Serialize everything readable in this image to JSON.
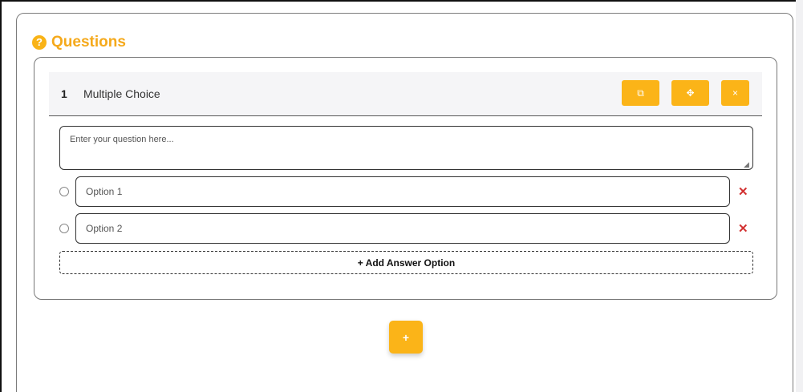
{
  "section": {
    "title": "Questions",
    "help_icon": "?"
  },
  "question": {
    "number": "1",
    "type": "Multiple Choice",
    "actions": {
      "duplicate_icon": "⧉",
      "move_icon": "✥",
      "delete_icon": "×"
    },
    "placeholder": "Enter your question here...",
    "options": [
      {
        "placeholder": "Option 1",
        "remove_icon": "✕"
      },
      {
        "placeholder": "Option 2",
        "remove_icon": "✕"
      }
    ],
    "add_option_label": "+ Add Answer Option"
  },
  "add_question_label": "+",
  "colors": {
    "accent": "#fbb418",
    "title": "#f5a91b",
    "remove": "#d23131"
  }
}
